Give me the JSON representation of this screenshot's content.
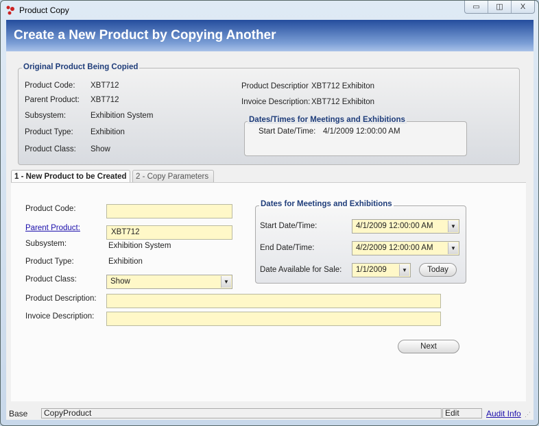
{
  "window": {
    "title": "Product Copy",
    "minimize": "▭",
    "maximize": "◫",
    "close": "X"
  },
  "banner": {
    "title": "Create a New Product by Copying Another"
  },
  "original": {
    "legend": "Original Product Being Copied",
    "fields": [
      {
        "label": "Product Code:",
        "value": "XBT712"
      },
      {
        "label": "Parent Product:",
        "value": "XBT712"
      },
      {
        "label": "Subsystem:",
        "value": "Exhibition System"
      },
      {
        "label": "Product Type:",
        "value": "Exhibition"
      },
      {
        "label": "Product Class:",
        "value": "Show"
      }
    ],
    "product_description_label": "Product Descriptior",
    "product_description": "XBT712 Exhibiton",
    "invoice_description_label": "Invoice Description:",
    "invoice_description": "XBT712 Exhibiton",
    "dates_legend": "Dates/Times for Meetings and Exhibitions",
    "start_label": "Start Date/Time:",
    "start_value": "4/1/2009 12:00:00 AM"
  },
  "tabs": [
    {
      "label": "1 - New Product to be Created",
      "active": true
    },
    {
      "label": "2 - Copy Parameters",
      "active": false
    }
  ],
  "form": {
    "product_code_label": "Product Code:",
    "product_code": "",
    "parent_product_label": "Parent Product:",
    "parent_product": "XBT712",
    "subsystem_label": "Subsystem:",
    "subsystem": "Exhibition System",
    "product_type_label": "Product Type:",
    "product_type": "Exhibition",
    "product_class_label": "Product Class:",
    "product_class": "Show",
    "product_description_label": "Product Description:",
    "product_description": "",
    "invoice_description_label": "Invoice Description:",
    "invoice_description": "",
    "dates_legend": "Dates for Meetings and Exhibitions",
    "start_label": "Start Date/Time:",
    "start_value": "4/1/2009 12:00:00 AM",
    "end_label": "End Date/Time:",
    "end_value": "4/2/2009 12:00:00 AM",
    "sale_label": "Date Available for Sale:",
    "sale_value": "1/1/2009",
    "today_button": "Today",
    "next_button": "Next"
  },
  "status": {
    "base": "Base",
    "context": "CopyProduct",
    "mode": "Edit",
    "audit": "Audit Info"
  },
  "colors": {
    "banner": "#244d9d",
    "input_bg": "#fff8c8",
    "legend": "#1f3d7a"
  }
}
